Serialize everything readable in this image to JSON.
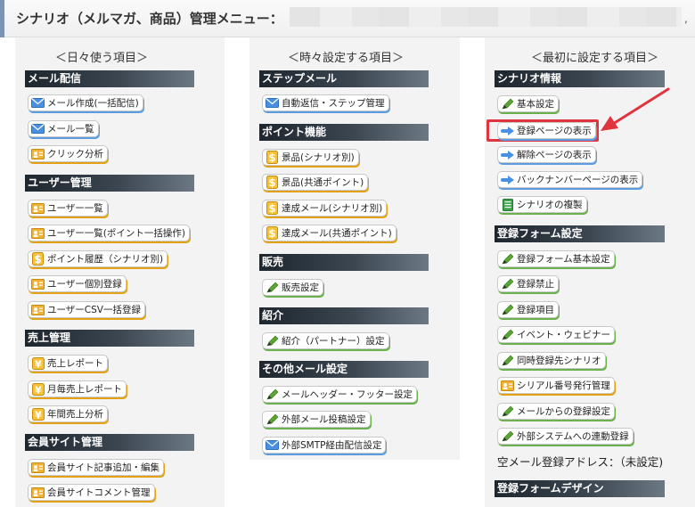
{
  "header": {
    "title": "シナリオ（メルマガ、商品）管理メニュー：",
    "trailing": ","
  },
  "colors": {
    "section_dark": "#1e262e",
    "highlight_red": "#e0353f",
    "shadow_green": "#6ab04c",
    "shadow_orange": "#e2a214",
    "shadow_blue": "#5b9be0"
  },
  "columns": [
    {
      "heading": "＜日々使う項目＞",
      "sections": [
        {
          "title": "メール配信",
          "items": [
            {
              "label": "メール作成(一括配信)",
              "icon": "envelope-icon"
            },
            {
              "label": "メール一覧",
              "icon": "envelope-icon"
            },
            {
              "label": "クリック分析",
              "icon": "person-card-icon"
            }
          ]
        },
        {
          "title": "ユーザー管理",
          "items": [
            {
              "label": "ユーザー一覧",
              "icon": "person-card-icon"
            },
            {
              "label": "ユーザー一覧(ポイント一括操作)",
              "icon": "person-card-icon"
            },
            {
              "label": "ポイント履歴（シナリオ別)",
              "icon": "dollar-icon"
            },
            {
              "label": "ユーザー個別登録",
              "icon": "person-card-icon"
            },
            {
              "label": "ユーザーCSV一括登録",
              "icon": "person-card-icon"
            }
          ]
        },
        {
          "title": "売上管理",
          "items": [
            {
              "label": "売上レポート",
              "icon": "yen-icon"
            },
            {
              "label": "月毎売上レポート",
              "icon": "yen-icon"
            },
            {
              "label": "年間売上分析",
              "icon": "yen-icon"
            }
          ]
        },
        {
          "title": "会員サイト管理",
          "items": [
            {
              "label": "会員サイト記事追加・編集",
              "icon": "person-card-icon"
            },
            {
              "label": "会員サイトコメント管理",
              "icon": "person-card-icon"
            }
          ]
        }
      ]
    },
    {
      "heading": "＜時々設定する項目＞",
      "sections": [
        {
          "title": "ステップメール",
          "items": [
            {
              "label": "自動返信・ステップ管理",
              "icon": "envelope-icon"
            }
          ]
        },
        {
          "title": "ポイント機能",
          "items": [
            {
              "label": "景品(シナリオ別)",
              "icon": "dollar-icon"
            },
            {
              "label": "景品(共通ポイント)",
              "icon": "dollar-icon"
            },
            {
              "label": "達成メール(シナリオ別)",
              "icon": "dollar-icon"
            },
            {
              "label": "達成メール(共通ポイント)",
              "icon": "dollar-icon"
            }
          ]
        },
        {
          "title": "販売",
          "items": [
            {
              "label": "販売設定",
              "icon": "pencil-icon"
            }
          ]
        },
        {
          "title": "紹介",
          "items": [
            {
              "label": "紹介（パートナー）設定",
              "icon": "pencil-icon"
            }
          ]
        },
        {
          "title": "その他メール設定",
          "items": [
            {
              "label": "メールヘッダー・フッター設定",
              "icon": "pencil-icon"
            },
            {
              "label": "外部メール投稿設定",
              "icon": "pencil-icon"
            },
            {
              "label": "外部SMTP経由配信設定",
              "icon": "envelope-icon"
            }
          ]
        }
      ]
    },
    {
      "heading": "＜最初に設定する項目＞",
      "sections": [
        {
          "title": "シナリオ情報",
          "items": [
            {
              "label": "基本設定",
              "icon": "pencil-icon"
            },
            {
              "label": "登録ページの表示",
              "icon": "blue-arrow-icon"
            },
            {
              "label": "解除ページの表示",
              "icon": "blue-arrow-icon"
            },
            {
              "label": "バックナンバーページの表示",
              "icon": "blue-arrow-icon"
            },
            {
              "label": "シナリオの複製",
              "icon": "document-icon"
            }
          ]
        },
        {
          "title": "登録フォーム設定",
          "items": [
            {
              "label": "登録フォーム基本設定",
              "icon": "pencil-icon"
            },
            {
              "label": "登録禁止",
              "icon": "pencil-icon"
            },
            {
              "label": "登録項目",
              "icon": "pencil-icon"
            },
            {
              "label": "イベント・ウェビナー",
              "icon": "pencil-icon"
            },
            {
              "label": "同時登録先シナリオ",
              "icon": "pencil-icon"
            },
            {
              "label": "シリアル番号発行管理",
              "icon": "person-card-icon"
            },
            {
              "label": "メールからの登録設定",
              "icon": "pencil-icon"
            },
            {
              "label": "外部システムへの連動登録",
              "icon": "pencil-icon"
            }
          ]
        },
        {
          "plain": "空メール登録アドレス：（未設定)"
        },
        {
          "title": "登録フォームデザイン",
          "items": []
        }
      ]
    }
  ]
}
